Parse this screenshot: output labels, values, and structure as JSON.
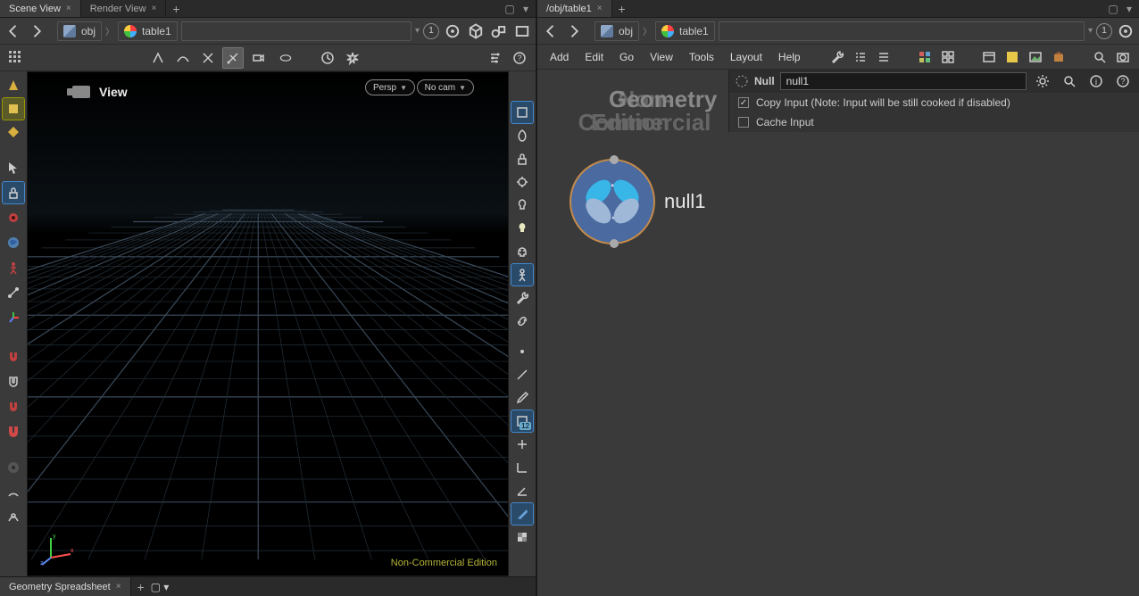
{
  "left": {
    "tabs": [
      {
        "label": "Scene View",
        "active": true
      },
      {
        "label": "Render View",
        "active": false
      }
    ],
    "nav": {
      "obj_label": "obj",
      "geo_label": "table1",
      "pin_count": "1"
    },
    "viewport": {
      "title": "View",
      "persp_label": "Persp",
      "cam_label": "No cam",
      "watermark": "Non-Commercial Edition",
      "right_toolbar_badge": "12"
    },
    "bottom_tab": "Geometry Spreadsheet"
  },
  "right": {
    "tab": "/obj/table1",
    "nav": {
      "obj_label": "obj",
      "geo_label": "table1",
      "pin_count": "1"
    },
    "menus": [
      "Add",
      "Edit",
      "Go",
      "View",
      "Tools",
      "Layout",
      "Help"
    ],
    "canvas": {
      "watermark_line1": "Non-Commercial",
      "watermark_line2": "Geometry",
      "watermark_line3": "Edition",
      "node_label": "null1"
    },
    "params": {
      "type_label": "Null",
      "name_value": "null1",
      "copy_input_label": "Copy Input (Note: Input will be still cooked if disabled)",
      "cache_input_label": "Cache Input"
    }
  }
}
